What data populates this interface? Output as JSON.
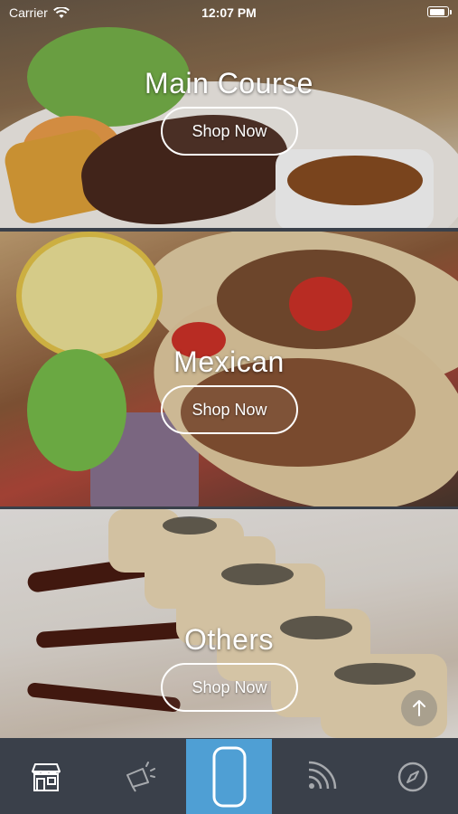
{
  "status_bar": {
    "carrier": "Carrier",
    "time": "12:07 PM",
    "battery_level": 0.9
  },
  "categories": [
    {
      "title": "Main Course",
      "button_label": "Shop Now"
    },
    {
      "title": "Mexican",
      "button_label": "Shop Now"
    },
    {
      "title": "Others",
      "button_label": "Shop Now"
    }
  ],
  "icons": {
    "scroll_top": "arrow-up-icon",
    "tabs": [
      "store-icon",
      "megaphone-icon",
      "phone-outline-icon",
      "rss-icon",
      "compass-icon"
    ]
  },
  "colors": {
    "tab_bar": "#3a404a",
    "tab_active": "#4f9fd4",
    "icon": "#ffffff"
  }
}
